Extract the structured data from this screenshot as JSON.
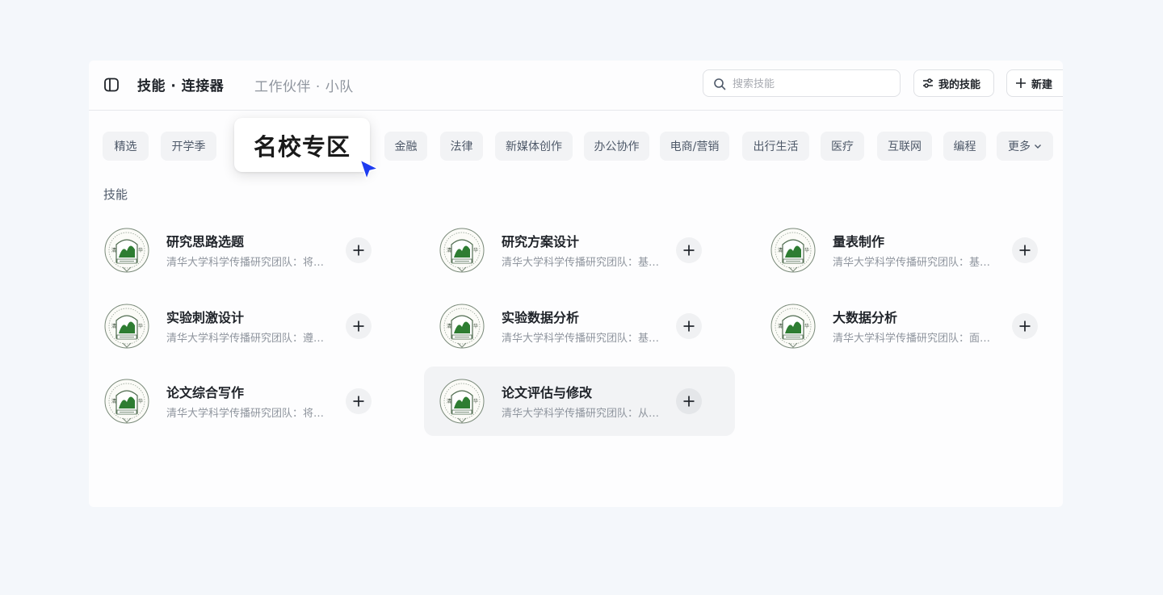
{
  "header": {
    "title": "技能 · 连接器",
    "subtitle": "工作伙伴 · 小队",
    "search_placeholder": "搜索技能",
    "my_skills_label": "我的技能",
    "new_label": "新建"
  },
  "categories": [
    "精选",
    "开学季",
    "名校专区",
    "金融",
    "法律",
    "新媒体创作",
    "办公协作",
    "电商/营销",
    "出行生活",
    "医疗",
    "互联网",
    "编程",
    "更多"
  ],
  "active_category": "名校专区",
  "section_title": "技能",
  "skills": [
    {
      "name": "研究思路选题",
      "desc": "清华大学科学传播研究团队：将…"
    },
    {
      "name": "研究方案设计",
      "desc": "清华大学科学传播研究团队：基…"
    },
    {
      "name": "量表制作",
      "desc": "清华大学科学传播研究团队：基…"
    },
    {
      "name": "实验刺激设计",
      "desc": "清华大学科学传播研究团队：遵…"
    },
    {
      "name": "实验数据分析",
      "desc": "清华大学科学传播研究团队：基…"
    },
    {
      "name": "大数据分析",
      "desc": "清华大学科学传播研究团队：面…"
    },
    {
      "name": "论文综合写作",
      "desc": "清华大学科学传播研究团队：将…"
    },
    {
      "name": "论文评估与修改",
      "desc": "清华大学科学传播研究团队：从…"
    }
  ],
  "colors": {
    "cursor": "#1e3cf0",
    "logo_green": "#2e7d32",
    "chip_bg": "#f2f3f5"
  }
}
